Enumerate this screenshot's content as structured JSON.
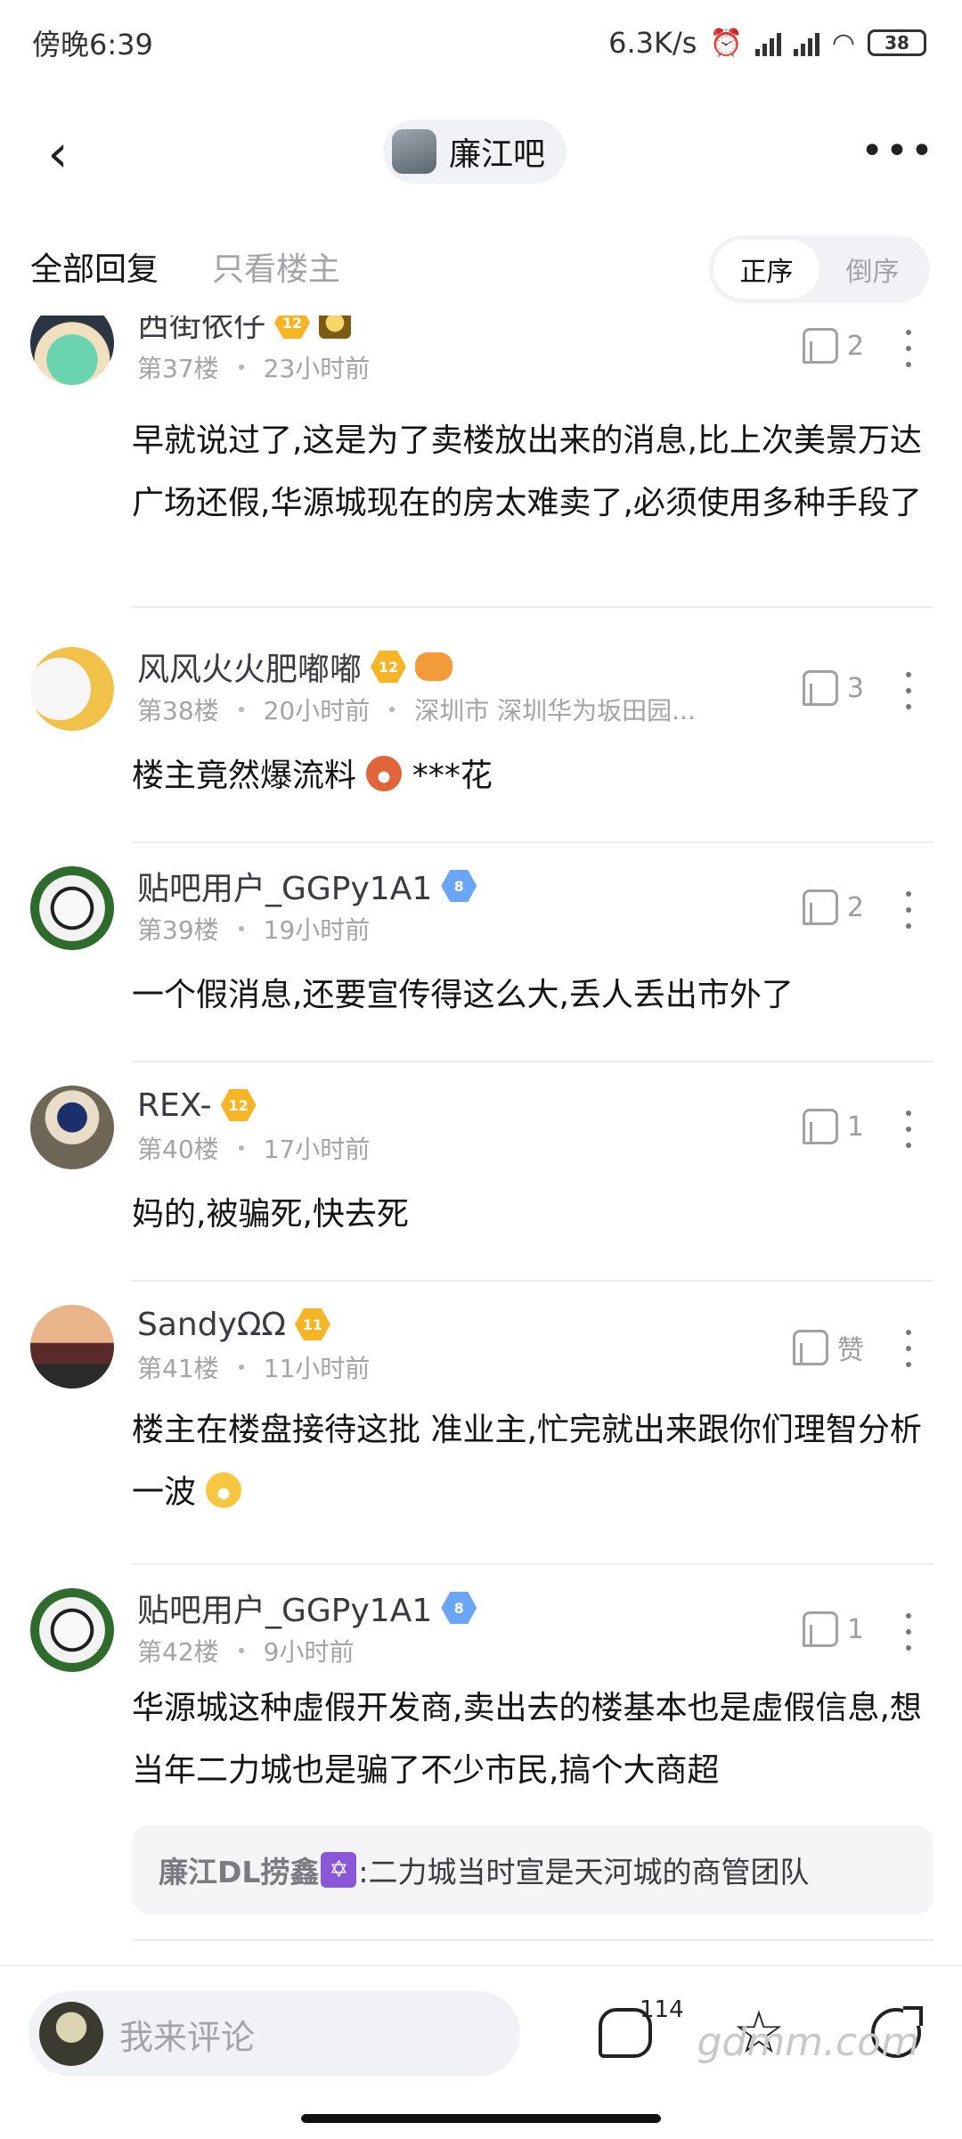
{
  "status_bar": {
    "time": "傍晚6:39",
    "speed": "6.3K/s",
    "battery": "38"
  },
  "header": {
    "back_icon": "chevron-left-icon",
    "forum_name": "廉江吧",
    "more_icon": "more-horizontal-icon"
  },
  "filter": {
    "tabs": [
      "全部回复",
      "只看楼主"
    ],
    "order_options": [
      "正序",
      "倒序"
    ]
  },
  "comments": [
    {
      "user": "西街依仔",
      "level": "12",
      "floor": "第37楼",
      "time": "23小时前",
      "location": "",
      "likes": "2",
      "text": "早就说过了,这是为了卖楼放出来的消息,比上次美景万达广场还假,华源城现在的房太难卖了,必须使用多种手段了"
    },
    {
      "user": "风风火火肥嘟嘟",
      "level": "12",
      "floor": "第38楼",
      "time": "20小时前",
      "location": "深圳市 深圳华为坂田园...",
      "likes": "3",
      "text_before": "楼主竟然爆流料",
      "text_after": "***花"
    },
    {
      "user": "贴吧用户_GGPy1A1",
      "level": "8",
      "floor": "第39楼",
      "time": "19小时前",
      "likes": "2",
      "text": "一个假消息,还要宣传得这么大,丢人丢出市外了"
    },
    {
      "user": "REX-",
      "level": "12",
      "floor": "第40楼",
      "time": "17小时前",
      "likes": "1",
      "text": "妈的,被骗死,快去死"
    },
    {
      "user": "SandyΩΩ",
      "level": "11",
      "floor": "第41楼",
      "time": "11小时前",
      "likes": "赞",
      "text": "楼主在楼盘接待这批 准业主,忙完就出来跟你们理智分析一波"
    },
    {
      "user": "贴吧用户_GGPy1A1",
      "level": "8",
      "floor": "第42楼",
      "time": "9小时前",
      "likes": "1",
      "text": "华源城这种虚假开发商,卖出去的楼基本也是虚假信息,想当年二力城也是骗了不少市民,搞个大商超",
      "reply_user": "廉江DL捞鑫",
      "reply_text": ":二力城当时宣是天河城的商管团队"
    }
  ],
  "bottom_bar": {
    "input_placeholder": "我来评论",
    "comment_count": "114"
  },
  "watermark": "gdmm.com"
}
